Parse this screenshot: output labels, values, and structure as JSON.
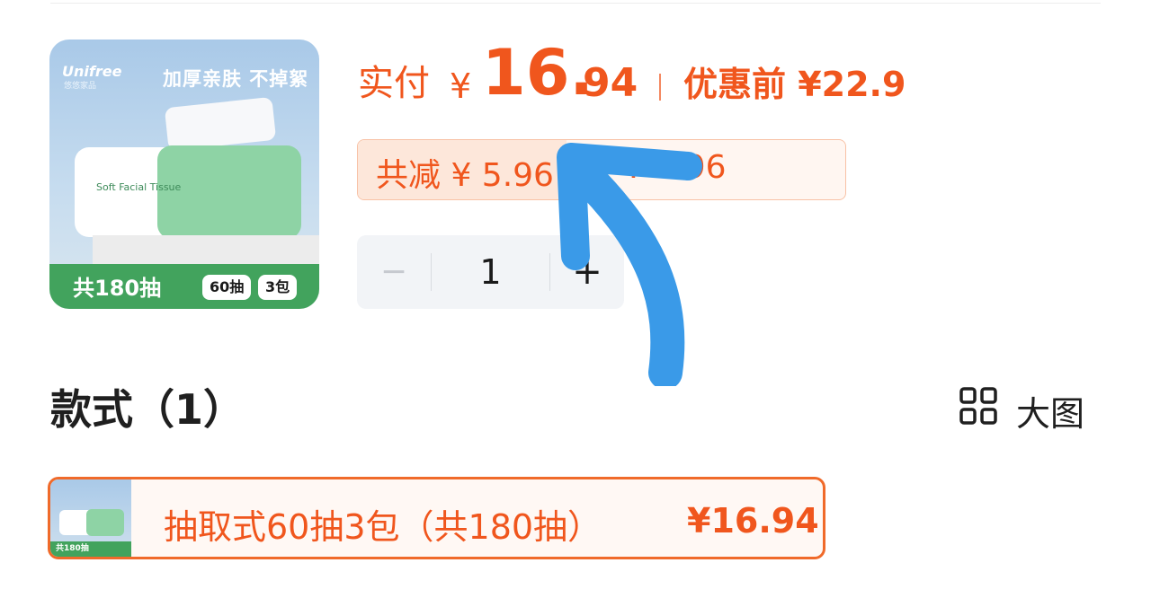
{
  "product": {
    "image_brand": "Unifree",
    "image_brand_cn": "悠悠家品",
    "image_slogan": "加厚亲肤 不掉絮",
    "image_pack_label": "Soft Facial Tissue",
    "image_total": "共180抽",
    "image_pill_count": "60抽",
    "image_pill_packs": "3包"
  },
  "price": {
    "paid_label": "实付",
    "currency": "¥",
    "paid_int": "16.",
    "paid_dec": "94",
    "original_label": "优惠前 ¥22.9"
  },
  "discount": {
    "total": "共减 ¥ 5.96",
    "coupon": "¥ 5.96"
  },
  "quantity": {
    "minus": "−",
    "value": "1",
    "plus": "+"
  },
  "styles": {
    "title": "款式（1）",
    "view_big_label": "大图",
    "options": [
      {
        "name": "抽取式60抽3包（共180抽）",
        "price": "¥16.94",
        "thumb_label": "共180抽"
      }
    ]
  },
  "colors": {
    "accent": "#f0561d",
    "annotation_arrow": "#3a9ae8"
  },
  "icons": {
    "view_big": "grid-icon"
  }
}
